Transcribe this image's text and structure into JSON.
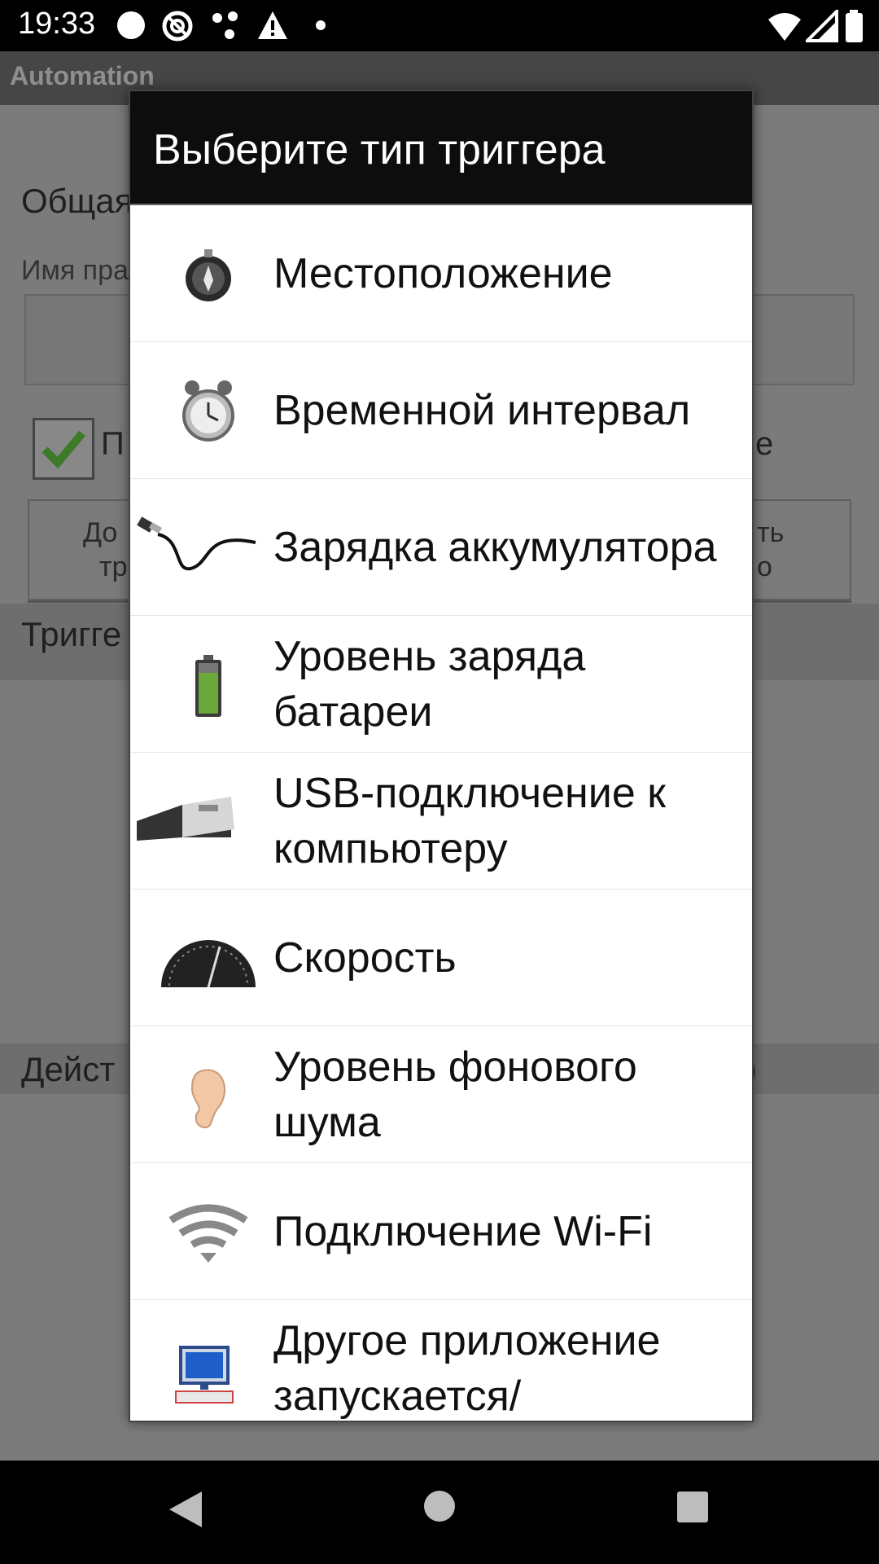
{
  "status_bar": {
    "time": "19:33",
    "icons": [
      "circle-icon",
      "at-icon",
      "dots-icon",
      "warning-icon",
      "dot-icon",
      "wifi-icon",
      "signal-icon",
      "battery-icon"
    ]
  },
  "background_app": {
    "title": "Automation",
    "section_general": "Общая",
    "name_label": "Имя пра",
    "checkbox_label_left": "П",
    "checkbox_label_right": "е",
    "button_left_line1": "До",
    "button_left_line2": "тр",
    "button_right_line1": "ть",
    "button_right_line2": "о",
    "section_triggers": "Тригге",
    "section_actions": "Дейст",
    "actions_suffix": ")"
  },
  "dialog": {
    "title": "Выберите тип триггера",
    "items": [
      {
        "label": "Местоположение",
        "icon": "compass-icon"
      },
      {
        "label": "Временной интервал",
        "icon": "alarm-clock-icon"
      },
      {
        "label": "Зарядка аккумулятора",
        "icon": "charger-cable-icon"
      },
      {
        "label": "Уровень заряда батареи",
        "icon": "battery-level-icon"
      },
      {
        "label": "USB-подключение к компьютеру",
        "icon": "usb-plug-icon"
      },
      {
        "label": "Скорость",
        "icon": "speedometer-icon"
      },
      {
        "label": "Уровень фонового шума",
        "icon": "ear-icon"
      },
      {
        "label": "Подключение Wi-Fi",
        "icon": "wifi-icon"
      },
      {
        "label": "Другое приложение запускается/",
        "icon": "computer-icon"
      }
    ]
  },
  "nav_bar": {
    "buttons": [
      "back-icon",
      "home-icon",
      "recents-icon"
    ]
  }
}
